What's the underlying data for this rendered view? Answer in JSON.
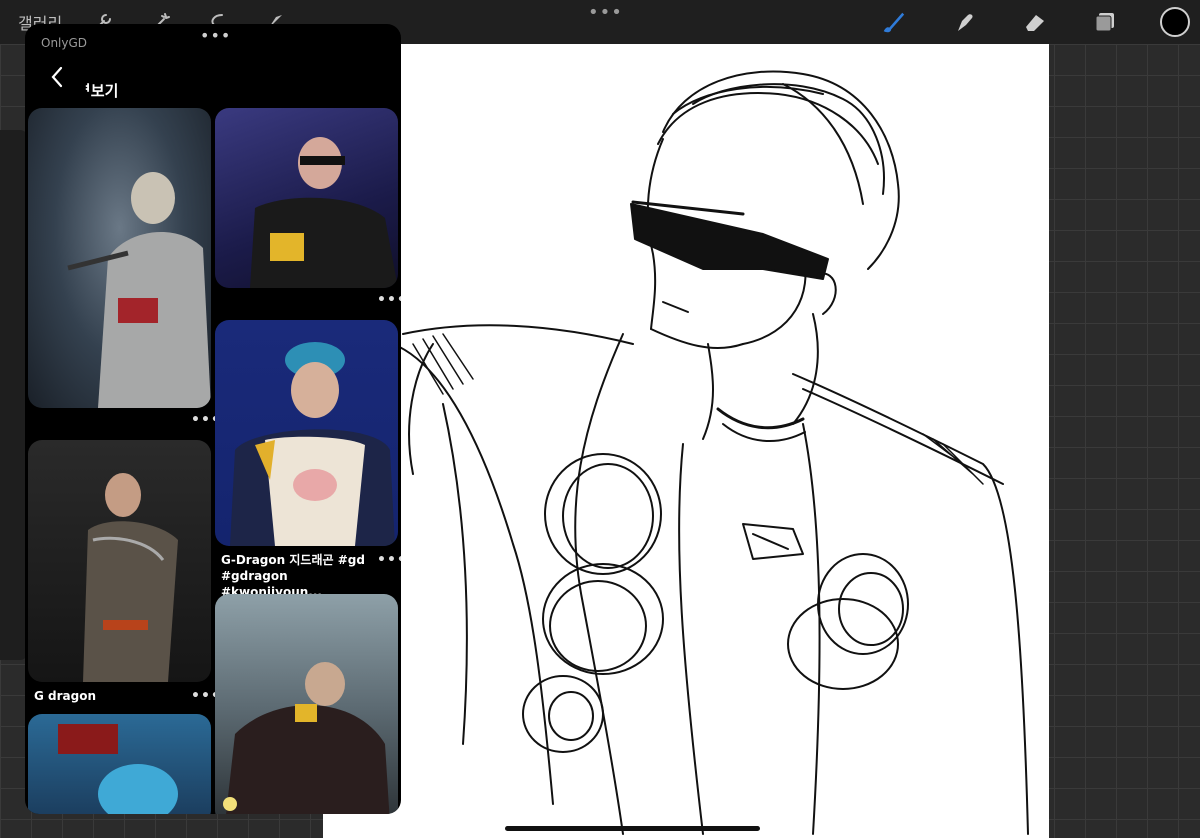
{
  "topbar": {
    "gallery_label": "갤러리",
    "more": "•••",
    "icons": [
      "wrench-icon",
      "magic-wand-icon",
      "selection-icon",
      "transform-arrow-icon",
      "brush-icon",
      "smudge-icon",
      "eraser-icon",
      "layers-icon",
      "color-swatch-icon"
    ],
    "brush_color": "#2f7bd9",
    "current_color": "#000000"
  },
  "panel": {
    "grabber": "•••",
    "source": "OnlyGD",
    "title": "ᅧ보기",
    "pins": [
      {
        "caption": "",
        "more": "•••"
      },
      {
        "caption": "",
        "more": "•••"
      },
      {
        "caption": "G-Dragon 지드래곤 #gd #gdragon #kwonjiyoun...",
        "more": "•••"
      },
      {
        "caption": "G dragon",
        "more": "•••"
      },
      {
        "caption": "",
        "more": ""
      },
      {
        "caption": "",
        "more": ""
      }
    ]
  }
}
